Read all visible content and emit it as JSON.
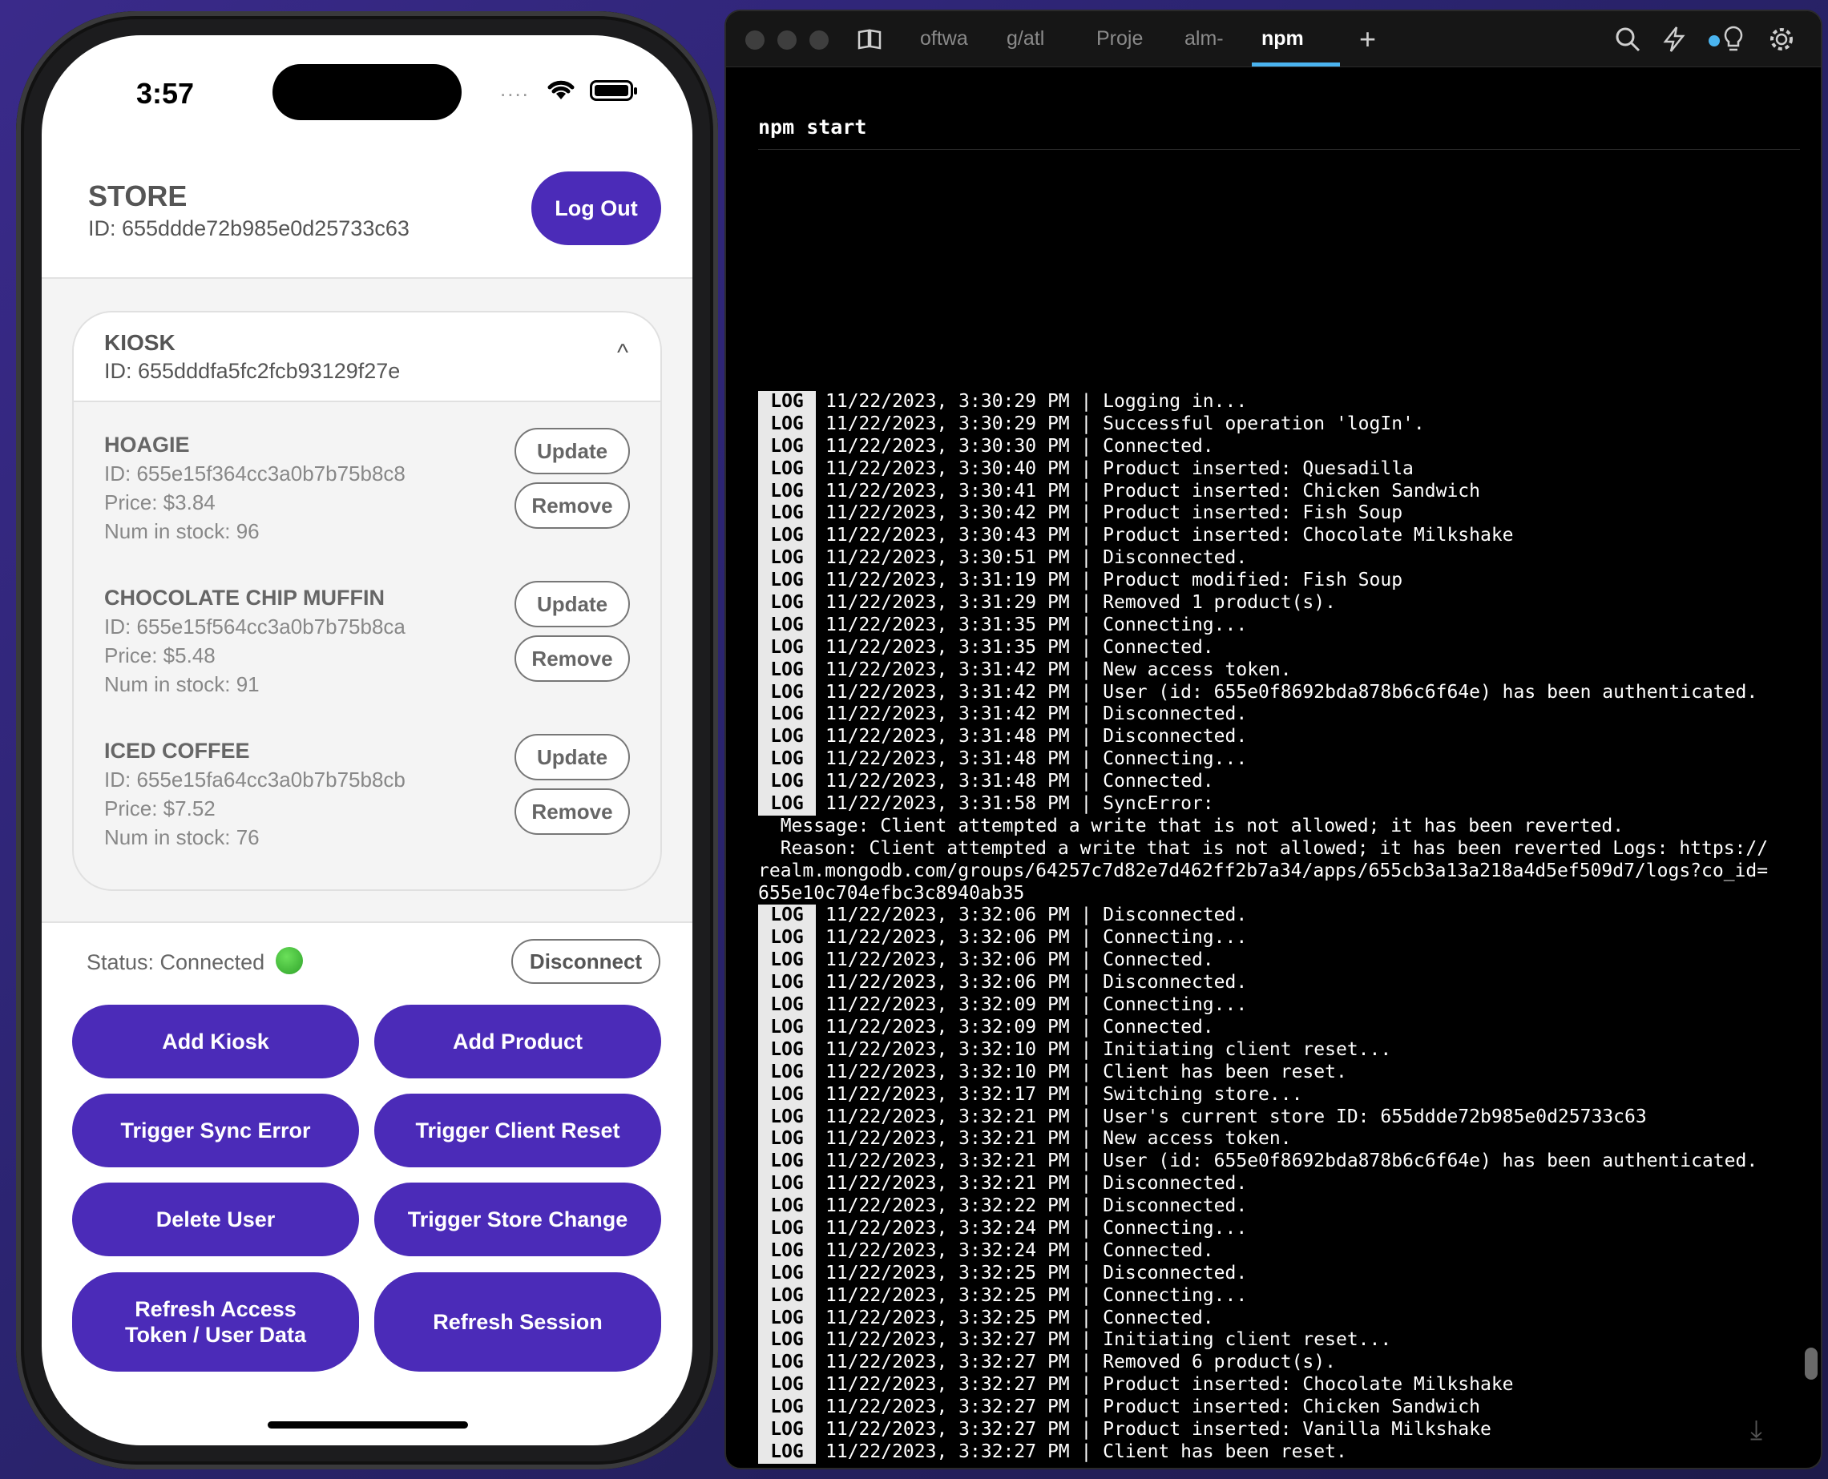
{
  "phone": {
    "time": "3:57",
    "signal_dots": "....",
    "store": {
      "title": "STORE",
      "id": "ID: 655ddde72b985e0d25733c63",
      "logout_label": "Log Out"
    },
    "kiosk": {
      "title": "KIOSK",
      "id": "ID: 655dddfa5fc2fcb93129f27e",
      "chevron": "^",
      "products": [
        {
          "name": "HOAGIE",
          "id": "ID: 655e15f364cc3a0b7b75b8c8",
          "price": "Price: $3.84",
          "stock": "Num in stock: 96",
          "update_label": "Update",
          "remove_label": "Remove"
        },
        {
          "name": "CHOCOLATE CHIP MUFFIN",
          "id": "ID: 655e15f564cc3a0b7b75b8ca",
          "price": "Price: $5.48",
          "stock": "Num in stock: 91",
          "update_label": "Update",
          "remove_label": "Remove"
        },
        {
          "name": "ICED COFFEE",
          "id": "ID: 655e15fa64cc3a0b7b75b8cb",
          "price": "Price: $7.52",
          "stock": "Num in stock: 76",
          "update_label": "Update",
          "remove_label": "Remove"
        }
      ]
    },
    "status": {
      "text": "Status: Connected",
      "disconnect_label": "Disconnect",
      "color": "#2fa32a"
    },
    "actions": [
      "Add Kiosk",
      "Add Product",
      "Trigger Sync Error",
      "Trigger Client Reset",
      "Delete User",
      "Trigger Store Change",
      "Refresh Access Token / User Data",
      "Refresh Session"
    ],
    "accent_color": "#4b2bb8"
  },
  "terminal": {
    "tabs": [
      "oftwa",
      "g/atl",
      "Proje",
      "alm-",
      "npm"
    ],
    "active_tab": "npm",
    "new_tab_icon": "plus-icon",
    "toolbar_icons": [
      "search-icon",
      "bolt-icon",
      "lightbulb-icon",
      "gear-icon"
    ],
    "command": "npm start",
    "log_tag": "LOG",
    "lines": [
      {
        "tag": "LOG",
        "text": "11/22/2023, 3:30:29 PM | Logging in..."
      },
      {
        "tag": "LOG",
        "text": "11/22/2023, 3:30:29 PM | Successful operation 'logIn'."
      },
      {
        "tag": "LOG",
        "text": "11/22/2023, 3:30:30 PM | Connected."
      },
      {
        "tag": "LOG",
        "text": "11/22/2023, 3:30:40 PM | Product inserted: Quesadilla"
      },
      {
        "tag": "LOG",
        "text": "11/22/2023, 3:30:41 PM | Product inserted: Chicken Sandwich"
      },
      {
        "tag": "LOG",
        "text": "11/22/2023, 3:30:42 PM | Product inserted: Fish Soup"
      },
      {
        "tag": "LOG",
        "text": "11/22/2023, 3:30:43 PM | Product inserted: Chocolate Milkshake"
      },
      {
        "tag": "LOG",
        "text": "11/22/2023, 3:30:51 PM | Disconnected."
      },
      {
        "tag": "LOG",
        "text": "11/22/2023, 3:31:19 PM | Product modified: Fish Soup"
      },
      {
        "tag": "LOG",
        "text": "11/22/2023, 3:31:29 PM | Removed 1 product(s)."
      },
      {
        "tag": "LOG",
        "text": "11/22/2023, 3:31:35 PM | Connecting..."
      },
      {
        "tag": "LOG",
        "text": "11/22/2023, 3:31:35 PM | Connected."
      },
      {
        "tag": "LOG",
        "text": "11/22/2023, 3:31:42 PM | New access token."
      },
      {
        "tag": "LOG",
        "text": "11/22/2023, 3:31:42 PM | User (id: 655e0f8692bda878b6c6f64e) has been authenticated."
      },
      {
        "tag": "LOG",
        "text": "11/22/2023, 3:31:42 PM | Disconnected."
      },
      {
        "tag": "LOG",
        "text": "11/22/2023, 3:31:48 PM | Disconnected."
      },
      {
        "tag": "LOG",
        "text": "11/22/2023, 3:31:48 PM | Connecting..."
      },
      {
        "tag": "LOG",
        "text": "11/22/2023, 3:31:48 PM | Connected."
      },
      {
        "tag": "LOG",
        "text": "11/22/2023, 3:31:58 PM | SyncError:"
      },
      {
        "tag": "",
        "text": "  Message: Client attempted a write that is not allowed; it has been reverted."
      },
      {
        "tag": "",
        "text": "  Reason: Client attempted a write that is not allowed; it has been reverted Logs: https://"
      },
      {
        "tag": "",
        "text": "realm.mongodb.com/groups/64257c7d82e7d462ff2b7a34/apps/655cb3a13a218a4d5ef509d7/logs?co_id="
      },
      {
        "tag": "",
        "text": "655e10c704efbc3c8940ab35"
      },
      {
        "tag": "LOG",
        "text": "11/22/2023, 3:32:06 PM | Disconnected."
      },
      {
        "tag": "LOG",
        "text": "11/22/2023, 3:32:06 PM | Connecting..."
      },
      {
        "tag": "LOG",
        "text": "11/22/2023, 3:32:06 PM | Connected."
      },
      {
        "tag": "LOG",
        "text": "11/22/2023, 3:32:06 PM | Disconnected."
      },
      {
        "tag": "LOG",
        "text": "11/22/2023, 3:32:09 PM | Connecting..."
      },
      {
        "tag": "LOG",
        "text": "11/22/2023, 3:32:09 PM | Connected."
      },
      {
        "tag": "LOG",
        "text": "11/22/2023, 3:32:10 PM | Initiating client reset..."
      },
      {
        "tag": "LOG",
        "text": "11/22/2023, 3:32:10 PM | Client has been reset."
      },
      {
        "tag": "LOG",
        "text": "11/22/2023, 3:32:17 PM | Switching store..."
      },
      {
        "tag": "LOG",
        "text": "11/22/2023, 3:32:21 PM | User's current store ID: 655ddde72b985e0d25733c63"
      },
      {
        "tag": "LOG",
        "text": "11/22/2023, 3:32:21 PM | New access token."
      },
      {
        "tag": "LOG",
        "text": "11/22/2023, 3:32:21 PM | User (id: 655e0f8692bda878b6c6f64e) has been authenticated."
      },
      {
        "tag": "LOG",
        "text": "11/22/2023, 3:32:21 PM | Disconnected."
      },
      {
        "tag": "LOG",
        "text": "11/22/2023, 3:32:22 PM | Disconnected."
      },
      {
        "tag": "LOG",
        "text": "11/22/2023, 3:32:24 PM | Connecting..."
      },
      {
        "tag": "LOG",
        "text": "11/22/2023, 3:32:24 PM | Connected."
      },
      {
        "tag": "LOG",
        "text": "11/22/2023, 3:32:25 PM | Disconnected."
      },
      {
        "tag": "LOG",
        "text": "11/22/2023, 3:32:25 PM | Connecting..."
      },
      {
        "tag": "LOG",
        "text": "11/22/2023, 3:32:25 PM | Connected."
      },
      {
        "tag": "LOG",
        "text": "11/22/2023, 3:32:27 PM | Initiating client reset..."
      },
      {
        "tag": "LOG",
        "text": "11/22/2023, 3:32:27 PM | Removed 6 product(s)."
      },
      {
        "tag": "LOG",
        "text": "11/22/2023, 3:32:27 PM | Product inserted: Chocolate Milkshake"
      },
      {
        "tag": "LOG",
        "text": "11/22/2023, 3:32:27 PM | Product inserted: Chicken Sandwich"
      },
      {
        "tag": "LOG",
        "text": "11/22/2023, 3:32:27 PM | Product inserted: Vanilla Milkshake"
      },
      {
        "tag": "LOG",
        "text": "11/22/2023, 3:32:27 PM | Client has been reset."
      }
    ]
  }
}
